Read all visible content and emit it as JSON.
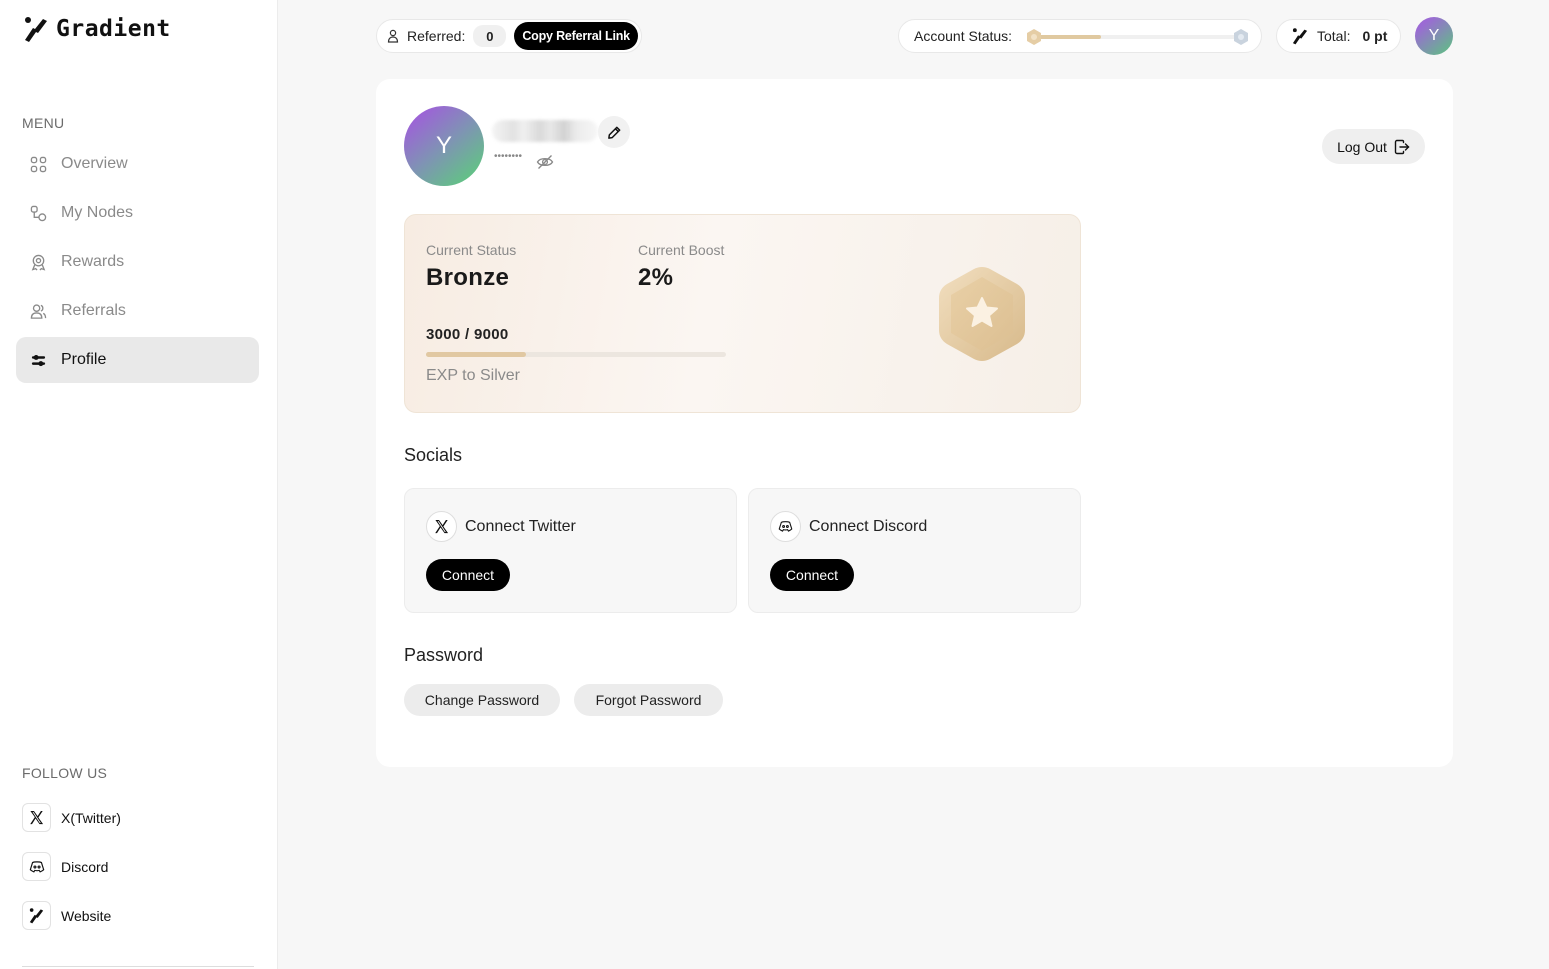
{
  "brand": {
    "name": "Gradient"
  },
  "sidebar": {
    "menu_label": "MENU",
    "items": [
      {
        "label": "Overview",
        "icon": "grid-icon",
        "active": false
      },
      {
        "label": "My Nodes",
        "icon": "nodes-icon",
        "active": false
      },
      {
        "label": "Rewards",
        "icon": "rewards-icon",
        "active": false
      },
      {
        "label": "Referrals",
        "icon": "users-icon",
        "active": false
      },
      {
        "label": "Profile",
        "icon": "profile-sliders-icon",
        "active": true
      }
    ],
    "follow_label": "FOLLOW US",
    "follow": [
      {
        "label": "X(Twitter)",
        "icon": "x-icon"
      },
      {
        "label": "Discord",
        "icon": "discord-icon"
      },
      {
        "label": "Website",
        "icon": "gradient-logo-icon"
      }
    ]
  },
  "topbar": {
    "referred_label": "Referred:",
    "referred_count": "0",
    "copy_referral_label": "Copy Referral Link",
    "account_status_label": "Account Status:",
    "account_status_progress": 0.33,
    "total_label": "Total:",
    "total_value": "0 pt",
    "avatar_letter": "Y"
  },
  "profile": {
    "avatar_letter": "Y",
    "masked_secret": "••••••••",
    "logout_label": "Log Out"
  },
  "status_card": {
    "current_status_label": "Current Status",
    "current_status_value": "Bronze",
    "current_boost_label": "Current Boost",
    "current_boost_value": "2%",
    "progress_text": "3000 / 9000",
    "progress_fraction": 0.3333,
    "exp_label": "EXP to Silver",
    "badge_icon": "bronze-star-badge-icon"
  },
  "socials": {
    "title": "Socials",
    "twitter_label": "Connect Twitter",
    "discord_label": "Connect Discord",
    "connect_label": "Connect"
  },
  "password": {
    "title": "Password",
    "change_label": "Change Password",
    "forgot_label": "Forgot Password"
  },
  "colors": {
    "accent_black": "#000000",
    "bronze": "#e0c9a0",
    "active_nav_bg": "#e9e9e9",
    "avatar_gradient_start": "#9c63d6",
    "avatar_gradient_end": "#5ccd7b"
  }
}
